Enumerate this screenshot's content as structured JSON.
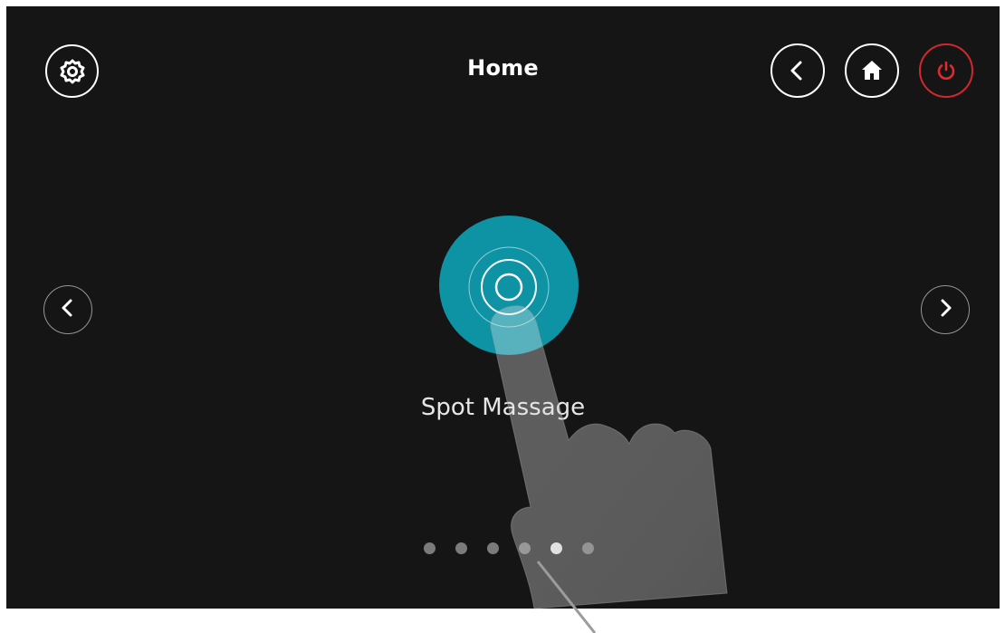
{
  "header": {
    "title": "Home",
    "settings_icon": "gear-icon",
    "back_icon": "chevron-left-icon",
    "home_icon": "home-icon",
    "power_icon": "power-icon",
    "power_color": "#d1272d"
  },
  "carousel": {
    "prev_icon": "chevron-left-icon",
    "next_icon": "chevron-right-icon",
    "current_mode": {
      "label": "Spot Massage",
      "icon": "target-rings-icon",
      "color": "#0e93a5"
    },
    "page_count": 6,
    "active_page": 5
  },
  "overlay": {
    "icon": "tap-hand-icon"
  }
}
